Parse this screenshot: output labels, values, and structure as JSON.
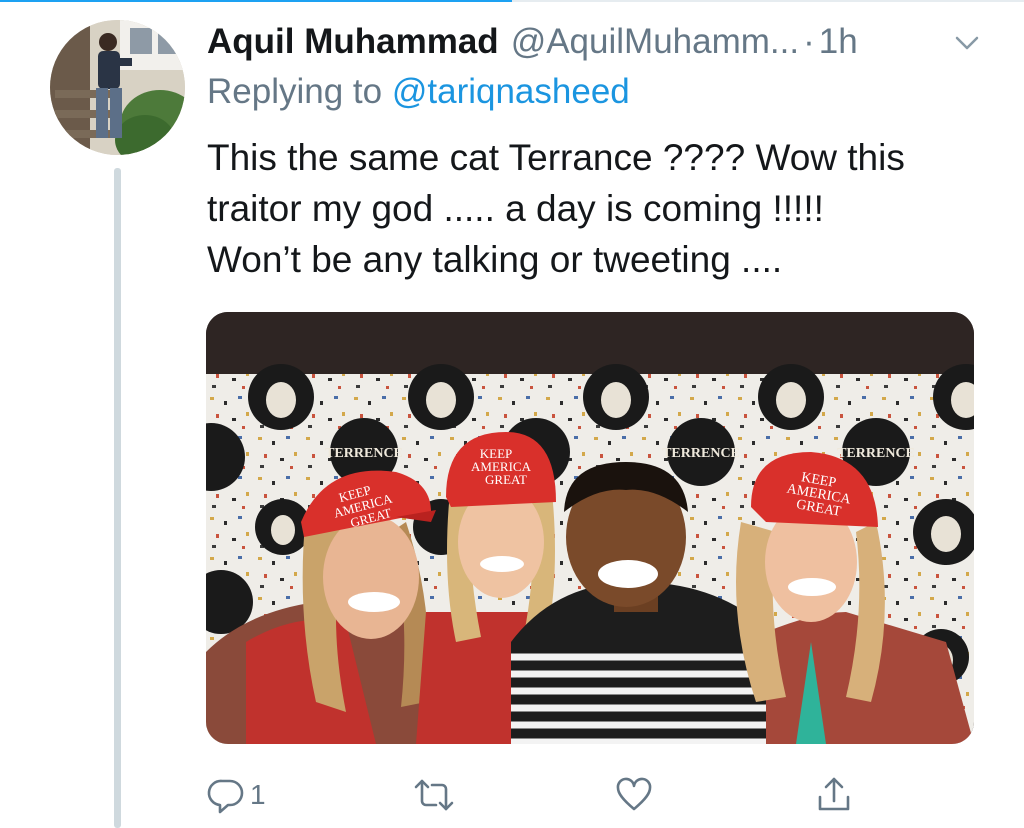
{
  "colors": {
    "accent": "#1b95e0",
    "text": "#14171a",
    "secondary": "#657786",
    "thread_line": "#cfd9de"
  },
  "header_bar": {
    "progress_fraction": 0.5
  },
  "tweet": {
    "author_name": "Aquil Muhammad",
    "author_handle": "@AquilMuhamm...",
    "separator": "·",
    "timestamp": "1h",
    "menu_icon": "chevron-down-icon",
    "replying_to_prefix": "Replying to",
    "replying_to_handle": "@tariqnasheed",
    "text_lines": [
      "This the same cat Terrance ???? Wow this",
      "traitor my god ..... a day is coming !!!!!",
      "Won’t be any talking or tweeting ...."
    ]
  },
  "media": {
    "backdrop_logo_text": "TERRENCE",
    "hat_text": [
      "KEEP",
      "AMERICA",
      "GREAT"
    ]
  },
  "actions": {
    "reply": {
      "icon": "reply-icon",
      "count": "1"
    },
    "retweet": {
      "icon": "retweet-icon",
      "count": ""
    },
    "like": {
      "icon": "heart-icon",
      "count": ""
    },
    "share": {
      "icon": "share-icon",
      "count": ""
    }
  }
}
